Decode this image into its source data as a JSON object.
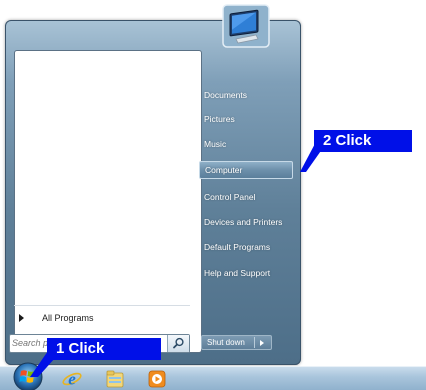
{
  "start_menu": {
    "all_programs_label": "All Programs",
    "search_placeholder": "Search programs and files",
    "shutdown_label": "Shut down",
    "right_items": [
      {
        "label": "Documents",
        "name": "menu-item-documents"
      },
      {
        "label": "Pictures",
        "name": "menu-item-pictures"
      },
      {
        "label": "Music",
        "name": "menu-item-music"
      },
      {
        "label": "Computer",
        "name": "menu-item-computer",
        "highlighted": true
      },
      {
        "label": "Control Panel",
        "name": "menu-item-control-panel"
      },
      {
        "label": "Devices and Printers",
        "name": "menu-item-devices-and-printers"
      },
      {
        "label": "Default Programs",
        "name": "menu-item-default-programs"
      },
      {
        "label": "Help and Support",
        "name": "menu-item-help-and-support"
      }
    ]
  },
  "taskbar": {
    "icons": [
      "windows-start-orb-icon",
      "internet-explorer-icon",
      "windows-explorer-icon",
      "media-player-icon"
    ]
  },
  "callouts": {
    "step1": "1 Click",
    "step2": "2 Click"
  },
  "colors": {
    "callout_blue": "#0010e8",
    "menu_frame": "#5f8099",
    "highlight": "#6d90ab"
  }
}
